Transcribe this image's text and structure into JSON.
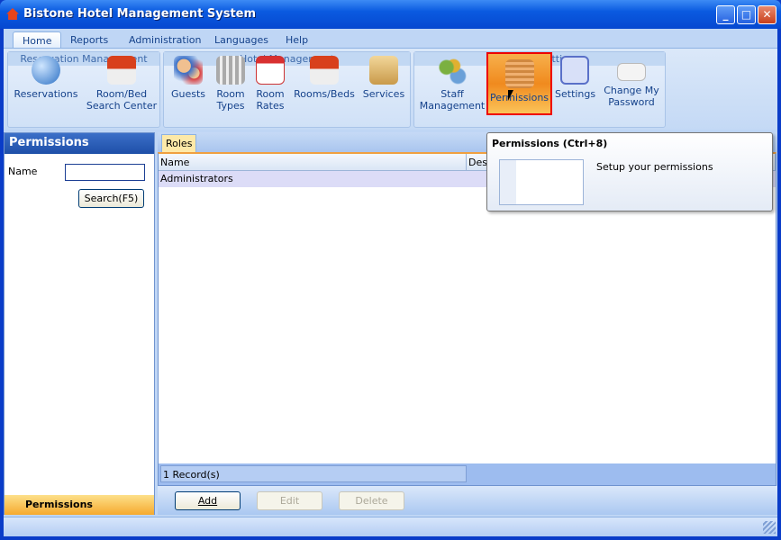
{
  "window": {
    "title": "Bistone Hotel Management System"
  },
  "menu": {
    "tabs": [
      {
        "label": "Home"
      },
      {
        "label": "Reports"
      },
      {
        "label": "Administration"
      },
      {
        "label": "Languages"
      },
      {
        "label": "Help"
      }
    ]
  },
  "ribbon": {
    "groups": [
      {
        "label": "Reservation Management",
        "items": [
          {
            "label": "Reservations",
            "icon": "globe-icon"
          },
          {
            "label": "Room/Bed Search Center",
            "icon": "house-search-icon"
          }
        ]
      },
      {
        "label": "Hotel Management",
        "items": [
          {
            "label": "Guests",
            "icon": "users-icon"
          },
          {
            "label": "Room Types",
            "icon": "building-icon"
          },
          {
            "label": "Room Rates",
            "icon": "calendar-icon"
          },
          {
            "label": "Rooms/Beds",
            "icon": "house-icon"
          },
          {
            "label": "Services",
            "icon": "box-icon"
          }
        ]
      },
      {
        "label": "System Settings",
        "items": [
          {
            "label": "Staff Management",
            "icon": "staff-icon"
          },
          {
            "label": "Permissions",
            "icon": "lock-icon",
            "selected": true
          },
          {
            "label": "Settings",
            "icon": "settings-check-icon"
          },
          {
            "label": "Change My Password",
            "icon": "password-icon"
          }
        ]
      }
    ]
  },
  "left": {
    "title": "Permissions",
    "name_label": "Name",
    "name_value": "",
    "search_button": "Search(F5)",
    "bottom_tab": "Permissions"
  },
  "main": {
    "tab": "Roles",
    "columns": [
      "Name",
      "Des"
    ],
    "rows": [
      [
        "Administrators",
        ""
      ]
    ],
    "record_count": "1 Record(s)",
    "buttons": {
      "add": "Add",
      "edit": "Edit",
      "delete": "Delete"
    }
  },
  "tooltip": {
    "title": "Permissions (Ctrl+8)",
    "text": "Setup your permissions"
  },
  "colors": {
    "title_bar": "#0a5ae0",
    "selected": "#f08a1e",
    "highlight_border": "#ee0000"
  }
}
